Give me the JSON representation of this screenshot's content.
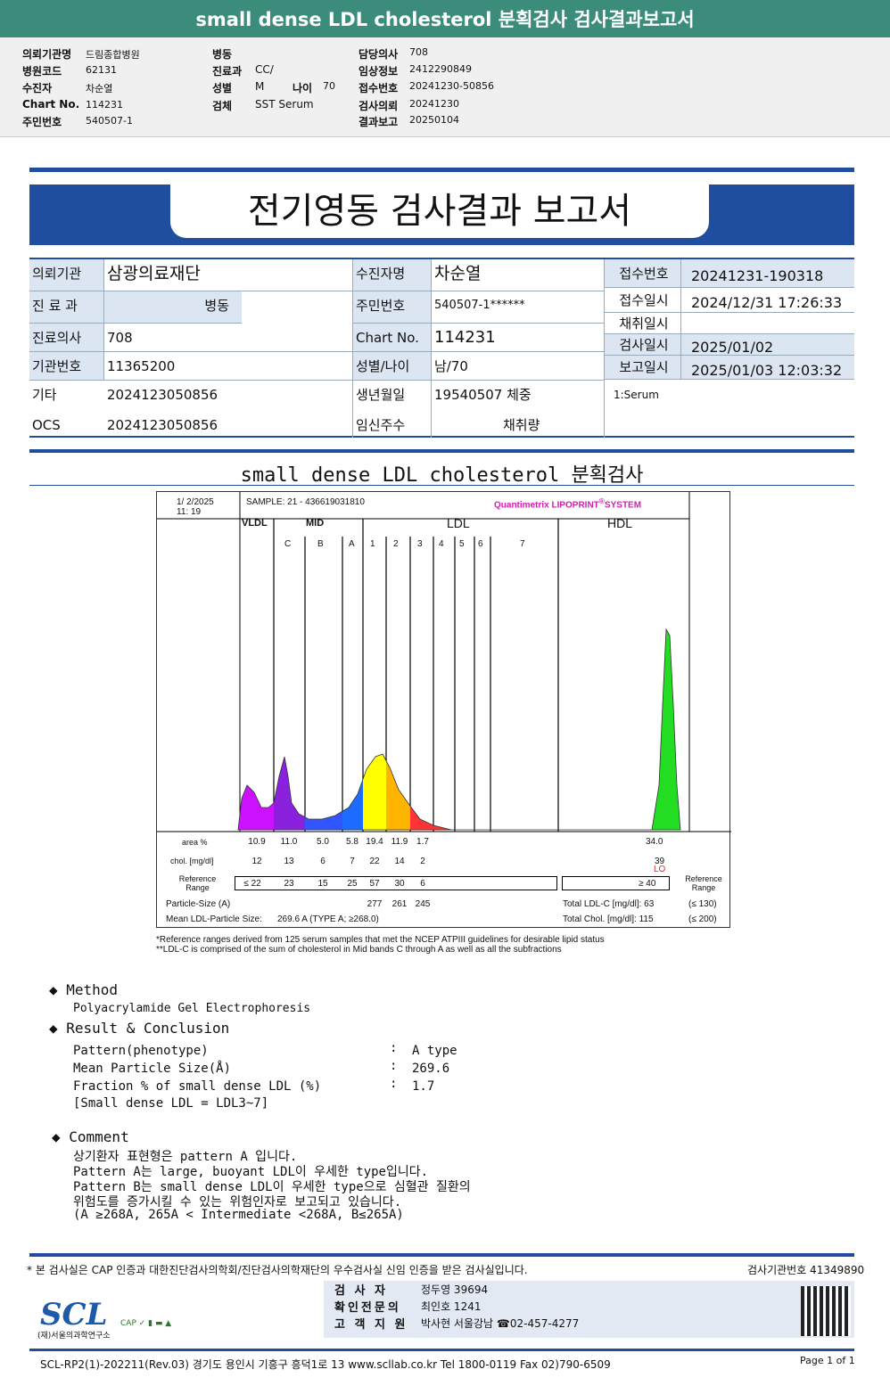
{
  "header": {
    "title": "small dense LDL cholesterol 분획검사 검사결과보고서"
  },
  "info": {
    "col1": [
      [
        "의뢰기관명",
        "드림종합병원"
      ],
      [
        "병원코드",
        "62131"
      ],
      [
        "수진자",
        "차순열"
      ],
      [
        "Chart No.",
        "114231"
      ],
      [
        "주민번호",
        "540507-1"
      ]
    ],
    "col2": [
      [
        "병동",
        ""
      ],
      [
        "진료과",
        "CC/"
      ],
      [
        "성별",
        "M"
      ],
      [
        "검체",
        "SST Serum"
      ]
    ],
    "age_label": "나이",
    "age": "70",
    "col3": [
      [
        "담당의사",
        "708"
      ],
      [
        "임상정보",
        "2412290849"
      ],
      [
        "접수번호",
        "20241230-50856"
      ],
      [
        "검사의뢰",
        "20241230"
      ],
      [
        "결과보고",
        "20250104"
      ]
    ]
  },
  "report": {
    "title": "전기영동 검사결과 보고서",
    "left": [
      {
        "label": "의뢰기관",
        "value": "삼광의료재단"
      },
      {
        "label": "진 료 과",
        "value": "병동"
      },
      {
        "label": "진료의사",
        "value": "708"
      },
      {
        "label": "기관번호",
        "value": "11365200"
      },
      {
        "label": "기타",
        "value": "2024123050856"
      },
      {
        "label": "OCS",
        "value": "2024123050856"
      }
    ],
    "mid": [
      {
        "label": "수진자명",
        "value": "차순열"
      },
      {
        "label": "주민번호",
        "value": "540507-1******"
      },
      {
        "label": "Chart No.",
        "value": "114231"
      },
      {
        "label": "성별/나이",
        "value": "남/70"
      },
      {
        "label": "생년월일",
        "value": "19540507 체중"
      },
      {
        "label": "임신주수",
        "value": "채취량"
      }
    ],
    "right": [
      {
        "label": "접수번호",
        "value": "20241231-190318"
      },
      {
        "label": "접수일시",
        "value": "2024/12/31 17:26:33"
      },
      {
        "label": "채취일시",
        "value": ""
      },
      {
        "label": "검사일시",
        "value": "2025/01/02"
      },
      {
        "label": "보고일시",
        "value": "2025/01/03 12:03:32"
      }
    ],
    "specimen": "1:Serum"
  },
  "section_title": "small dense LDL cholesterol 분획검사",
  "lipoprint": {
    "date": "1/  2/2025",
    "time": "11:  19",
    "sample": "SAMPLE:    21 - 436619031810",
    "brand": "Quantimetrix LIPOPRINT",
    "brand_mark": "®",
    "brand_tail": "SYSTEM",
    "groups": [
      "VLDL",
      "MID",
      "LDL",
      "HDL"
    ],
    "bands": [
      "C",
      "B",
      "A",
      "1",
      "2",
      "3",
      "4",
      "5",
      "6",
      "7"
    ],
    "band_colors": {
      "VLDL": "#cc11ff",
      "C": "#8a22dd",
      "B": "#3355ff",
      "A": "#1d6cff",
      "1": "#ffff00",
      "2": "#ffb400",
      "3": "#ff3333",
      "HDL": "#22dd22"
    },
    "row_labels": {
      "area": "area %",
      "chol": "chol. [mg/dl]",
      "ref": "Reference Range",
      "ref_right": "Reference Range",
      "psize": "Particle-Size (A)",
      "mean": "Mean LDL-Particle Size:"
    },
    "area": [
      "10.9",
      "11.0",
      "5.0",
      "5.8",
      "19.4",
      "11.9",
      "1.7"
    ],
    "area_hdl": "34.0",
    "chol": [
      "12",
      "13",
      "6",
      "7",
      "22",
      "14",
      "2"
    ],
    "chol_hdl": "39",
    "hdl_flag": "LO",
    "ref": [
      "≤ 22",
      "23",
      "15",
      "25",
      "57",
      "30",
      "6"
    ],
    "ref_hdl": "≥  40",
    "psize": [
      "277",
      "261",
      "245"
    ],
    "mean": "269.6  A    (TYPE A; ≥268.0)",
    "ldl_c_label": "Total LDL-C  [mg/dl]:  63",
    "ldl_c_ref": "(≤ 130)",
    "tchol_label": "Total Chol.  [mg/dl]:     115",
    "tchol_ref": "(≤ 200)",
    "note1": "*Reference ranges derived from 125 serum samples that met the NCEP ATPIII guidelines for desirable lipid status",
    "note2": "**LDL-C is comprised of the sum of cholesterol in Mid bands C through A as well as all the subfractions"
  },
  "method": {
    "title": "Method",
    "text": "Polyacrylamide Gel Electrophoresis"
  },
  "result": {
    "title": "Result & Conclusion",
    "rows": [
      [
        "Pattern(phenotype)",
        ":",
        "A type"
      ],
      [
        "Mean Particle Size(Å)",
        ":",
        "269.6"
      ],
      [
        "Fraction % of small dense LDL (%)",
        ":",
        "1.7"
      ]
    ],
    "note": "[Small dense LDL = LDL3~7]"
  },
  "comment": {
    "title": "Comment",
    "lines": [
      "상기환자 표현형은 pattern A 입니다.",
      "Pattern A는 large, buoyant LDL이 우세한 type입니다.",
      "Pattern B는 small dense LDL이 우세한 type으로 심혈관 질환의",
      "위험도를 증가시킬 수 있는 위험인자로 보고되고 있습니다.",
      "(A ≥268A, 265A < Intermediate <268A, B≤265A)"
    ]
  },
  "footer": {
    "cert": "* 본 검사실은 CAP 인증과 대한진단검사의학회/진단검사의학재단의 우수검사실 신임 인증을 받은 검사실입니다.",
    "org_no": "검사기관번호 41349890",
    "staff": [
      [
        "검  사  자",
        "정두영 39694"
      ],
      [
        "확인전문의",
        "최인호 1241"
      ],
      [
        "고 객 지 원",
        "박사현 서울강남 ☎02-457-4277"
      ]
    ],
    "logo": "SCL",
    "logo_sub": "(재)서울의과학연구소",
    "line": "SCL-RP2(1)-202211(Rev.03)  경기도 용인시 기흥구 흥덕1로 13  www.scllab.co.kr   Tel 1800-0119    Fax 02)790-6509",
    "page": "Page 1 of 1"
  }
}
